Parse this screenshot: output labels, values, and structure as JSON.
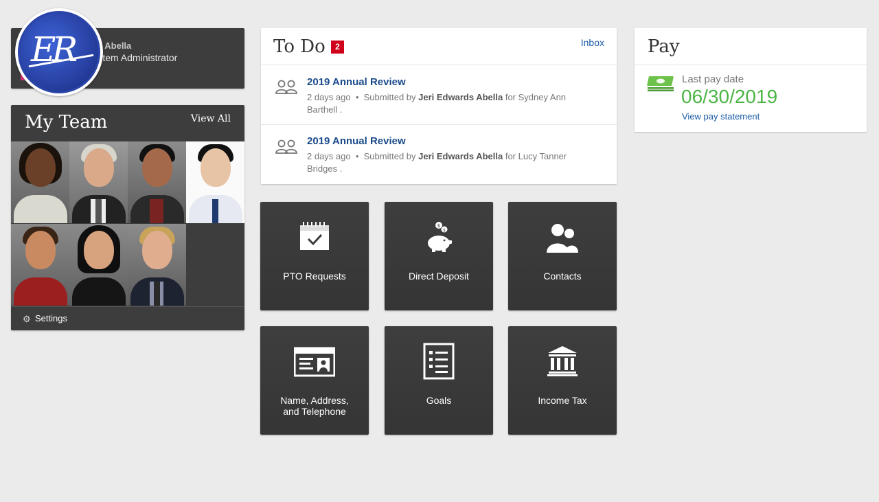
{
  "profile": {
    "name": "Jeri Abella",
    "role": "System Administrator",
    "logo_text": "ER"
  },
  "team": {
    "title": "My Team",
    "view_all": "View All",
    "settings": "Settings"
  },
  "todo": {
    "title": "To Do",
    "badge": "2",
    "inbox": "Inbox",
    "items": [
      {
        "title": "2019 Annual Review",
        "time": "2 days ago",
        "sep": "•",
        "submitted_prefix": "Submitted by",
        "submitter": "Jeri Edwards Abella",
        "for_prefix": "for",
        "target": "Sydney Ann Barthell ."
      },
      {
        "title": "2019 Annual Review",
        "time": "2 days ago",
        "sep": "•",
        "submitted_prefix": "Submitted by",
        "submitter": "Jeri Edwards Abella",
        "for_prefix": "for",
        "target": "Lucy Tanner Bridges ."
      }
    ]
  },
  "pay": {
    "title": "Pay",
    "last_pay_label": "Last pay date",
    "last_pay_date": "06/30/2019",
    "link": "View pay statement"
  },
  "tiles": [
    {
      "label": "PTO Requests",
      "icon": "calendar-check-icon"
    },
    {
      "label": "Direct Deposit",
      "icon": "piggy-bank-icon"
    },
    {
      "label": "Contacts",
      "icon": "contacts-icon"
    },
    {
      "label": "Name, Address,",
      "label2": "and Telephone",
      "icon": "id-card-icon"
    },
    {
      "label": "Goals",
      "icon": "checklist-icon"
    },
    {
      "label": "Income Tax",
      "icon": "bank-building-icon"
    }
  ],
  "colors": {
    "accent_blue": "#1a5ba6",
    "badge_red": "#d0021b",
    "pay_green": "#4bb543",
    "tile_dark": "#3b3b3b"
  }
}
